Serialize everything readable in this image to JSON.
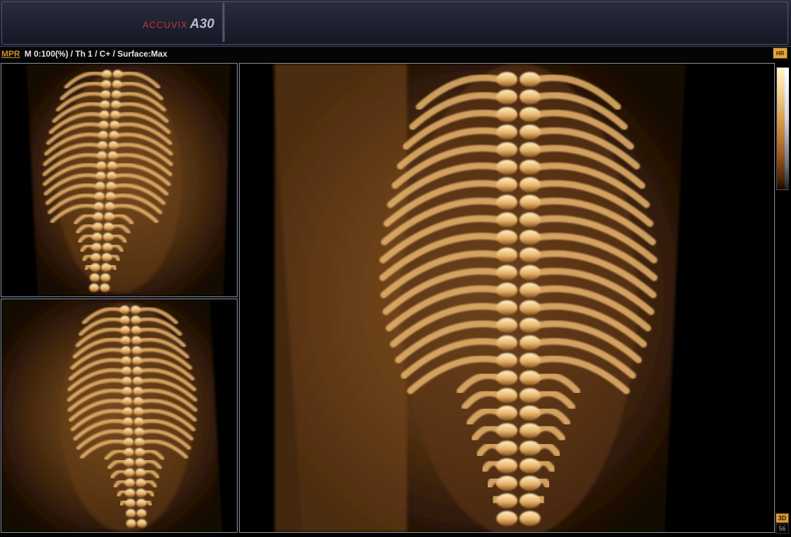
{
  "header": {
    "logo_word": "ACCUVIX",
    "logo_model": "A30"
  },
  "status": {
    "mode_tab": "MPR",
    "params": "M 0:100(%) / Th 1 / C+ / Surface:Max"
  },
  "toolbar": {
    "hr_icon_label": "HR"
  },
  "corner": {
    "badge_3d": "3D",
    "frame_number": "56"
  },
  "colors": {
    "accent_orange": "#c8902e",
    "logo_red": "#c8323a",
    "viewport_border": "#8b93a6",
    "render_tint": "#c48436"
  },
  "viewports": [
    {
      "name": "top-left-3d-render",
      "content": "fetal spine surface render"
    },
    {
      "name": "bottom-left-3d-render",
      "content": "fetal spine surface render"
    },
    {
      "name": "main-3d-render",
      "content": "fetal spine surface render"
    }
  ]
}
